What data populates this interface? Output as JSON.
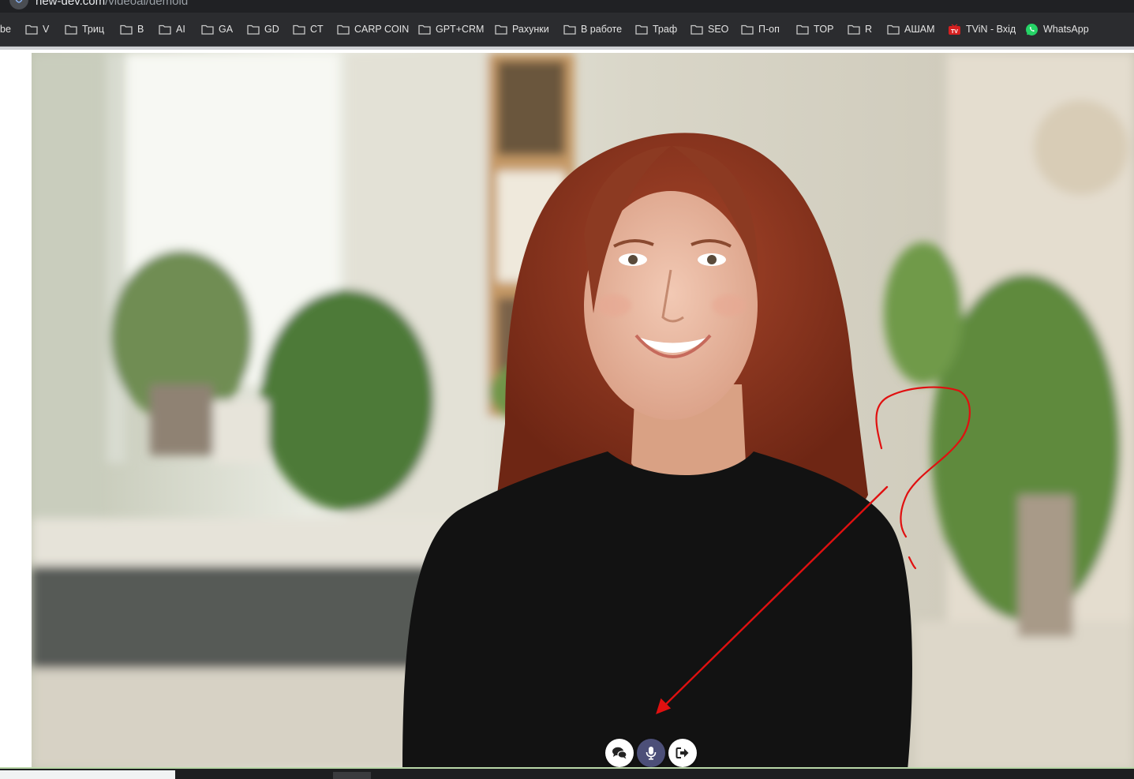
{
  "browser": {
    "url_host": "new-dev.com",
    "url_path": "/videoai/demoid"
  },
  "bookmarks": [
    {
      "label": "be",
      "icon": "none"
    },
    {
      "label": "V",
      "icon": "folder-icon"
    },
    {
      "label": "Триц",
      "icon": "folder-icon"
    },
    {
      "label": "B",
      "icon": "folder-icon"
    },
    {
      "label": "AI",
      "icon": "folder-icon"
    },
    {
      "label": "GA",
      "icon": "folder-icon"
    },
    {
      "label": "GD",
      "icon": "folder-icon"
    },
    {
      "label": "CT",
      "icon": "folder-icon"
    },
    {
      "label": "CARP COIN",
      "icon": "folder-icon"
    },
    {
      "label": "GPT+CRM",
      "icon": "folder-icon"
    },
    {
      "label": "Рахунки",
      "icon": "folder-icon"
    },
    {
      "label": "В работе",
      "icon": "folder-icon"
    },
    {
      "label": "Траф",
      "icon": "folder-icon"
    },
    {
      "label": "SEO",
      "icon": "folder-icon"
    },
    {
      "label": "П-оп",
      "icon": "folder-icon"
    },
    {
      "label": "TOP",
      "icon": "folder-icon"
    },
    {
      "label": "R",
      "icon": "folder-icon"
    },
    {
      "label": "АШАМ",
      "icon": "folder-icon"
    },
    {
      "label": "TViN - Вхід",
      "icon": "tvin-logo-icon"
    },
    {
      "label": "WhatsApp",
      "icon": "whatsapp-icon"
    }
  ],
  "video_controls": [
    {
      "name": "chat-button",
      "icon": "chat-bubbles-icon"
    },
    {
      "name": "microphone-button",
      "icon": "microphone-icon",
      "active": true
    },
    {
      "name": "exit-button",
      "icon": "exit-icon"
    }
  ],
  "colors": {
    "annotation": "#e01010",
    "mic_active": "#4c4f78",
    "whatsapp": "#25d366",
    "tvin": "#d62020"
  }
}
